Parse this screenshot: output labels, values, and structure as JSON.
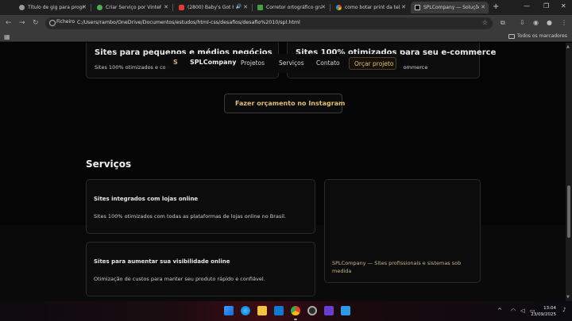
{
  "browser": {
    "tabs": [
      {
        "label": "Título de gig para program",
        "color": "#9a9a9a"
      },
      {
        "label": "Criar Serviço por VintePila",
        "color": "#4caf50"
      },
      {
        "label": "(2800) Baby's Got Her",
        "color": "#e53935"
      },
      {
        "label": "Corretor ortográfico gratu",
        "color": "#43a047"
      },
      {
        "label": "como botar print da tela d",
        "color": "#4285f4"
      },
      {
        "label": "SPLCompany — Soluçõe",
        "color": "#cccccc"
      }
    ],
    "url_chip": "Ficheiro",
    "url": "C:/Users/rambo/OneDrive/Documentos/estudos/html-css/desafios/desafio%2010/spl.html",
    "all_bookmarks": "Todos os marcadores"
  },
  "page": {
    "top_cards": [
      {
        "title": "Sites para pequenos e médios negócios",
        "text": "Sites 100% otimizados e com"
      },
      {
        "title": "Sites 100% otimizados para seu e-commerce",
        "text": "commerce"
      }
    ],
    "navbar": {
      "logo": "S",
      "brand": "SPLCompany",
      "links": [
        "Projetos",
        "Serviços",
        "Contato"
      ],
      "cta": "Orçar projeto"
    },
    "instagram_button": "Fazer orçamento no Instagram",
    "services_title": "Serviços",
    "services": [
      {
        "title": "Sites integrados com lojas online",
        "text": "Sites 100% otimizados com todas as plataformas de lojas online no Brasil."
      },
      {
        "title": "Sites para aumentar sua visibilidade online",
        "text": "Otimização de custos para manter seu produto rápido e confiável."
      }
    ],
    "footer_line1": "SPLCompany — Sites profissionais e sistemas sob",
    "footer_line2": "medida"
  },
  "taskbar": {
    "time": "13:04",
    "date": "23/09/2025"
  }
}
